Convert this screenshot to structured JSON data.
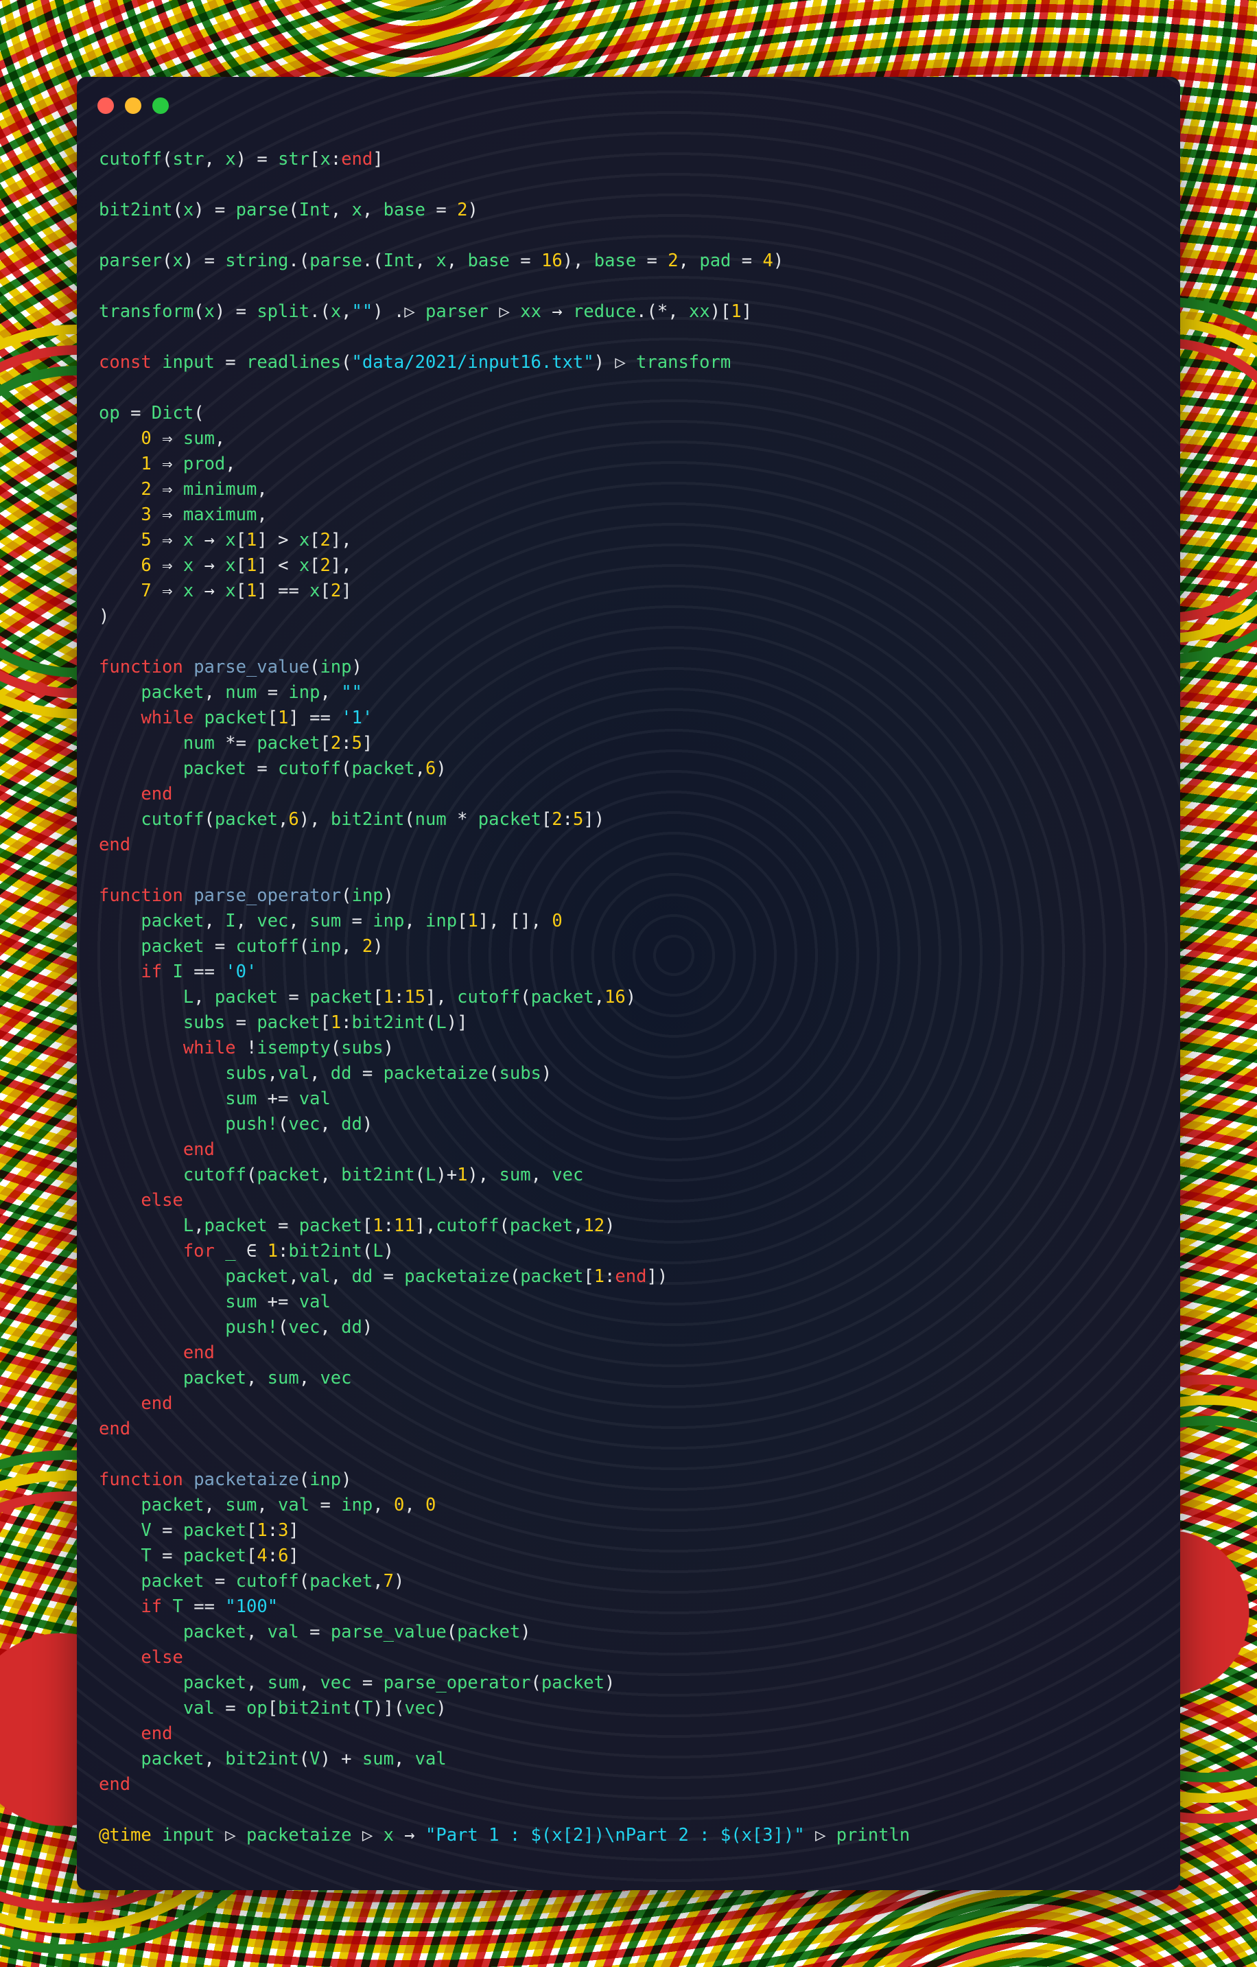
{
  "window": {
    "controls": [
      "close",
      "minimize",
      "maximize"
    ]
  },
  "code_lines": [
    "cutoff(str, x) = str[x:end]",
    "",
    "bit2int(x) = parse(Int, x, base = 2)",
    "",
    "parser(x) = string.(parse.(Int, x, base = 16), base = 2, pad = 4)",
    "",
    "transform(x) = split.(x,\"\") .▷ parser ▷ xx → reduce.(*, xx)[1]",
    "",
    "const input = readlines(\"data/2021/input16.txt\") ▷ transform",
    "",
    "op = Dict(",
    "    0 ⇒ sum,",
    "    1 ⇒ prod,",
    "    2 ⇒ minimum,",
    "    3 ⇒ maximum,",
    "    5 ⇒ x → x[1] > x[2],",
    "    6 ⇒ x → x[1] < x[2],",
    "    7 ⇒ x → x[1] == x[2]",
    ")",
    "",
    "function parse_value(inp)",
    "    packet, num = inp, \"\"",
    "    while packet[1] == '1'",
    "        num *= packet[2:5]",
    "        packet = cutoff(packet,6)",
    "    end",
    "    cutoff(packet,6), bit2int(num * packet[2:5])",
    "end",
    "",
    "function parse_operator(inp)",
    "    packet, I, vec, sum = inp, inp[1], [], 0",
    "    packet = cutoff(inp, 2)",
    "    if I == '0'",
    "        L, packet = packet[1:15], cutoff(packet,16)",
    "        subs = packet[1:bit2int(L)]",
    "        while !isempty(subs)",
    "            subs,val, dd = packetaize(subs)",
    "            sum += val",
    "            push!(vec, dd)",
    "        end",
    "        cutoff(packet, bit2int(L)+1), sum, vec",
    "    else",
    "        L,packet = packet[1:11],cutoff(packet,12)",
    "        for _ ∈ 1:bit2int(L)",
    "            packet,val, dd = packetaize(packet[1:end])",
    "            sum += val",
    "            push!(vec, dd)",
    "        end",
    "        packet, sum, vec",
    "    end",
    "end",
    "",
    "function packetaize(inp)",
    "    packet, sum, val = inp, 0, 0",
    "    V = packet[1:3]",
    "    T = packet[4:6]",
    "    packet = cutoff(packet,7)",
    "    if T == \"100\"",
    "        packet, val = parse_value(packet)",
    "    else",
    "        packet, sum, vec = parse_operator(packet)",
    "        val = op[bit2int(T)](vec)",
    "    end",
    "    packet, bit2int(V) + sum, val",
    "end",
    "",
    "@time input ▷ packetaize ▷ x → \"Part 1 : $(x[2])\\nPart 2 : $(x[3])\" ▷ println"
  ],
  "colors": {
    "keyword": "#ef4444",
    "function_name": "#7aa2c4",
    "identifier": "#4ade80",
    "number": "#facc15",
    "string": "#22d3ee",
    "operator": "#e5e7eb",
    "window_bg": "#16172a",
    "close": "#ff5f57",
    "minimize": "#febc2e",
    "maximize": "#28c840"
  }
}
